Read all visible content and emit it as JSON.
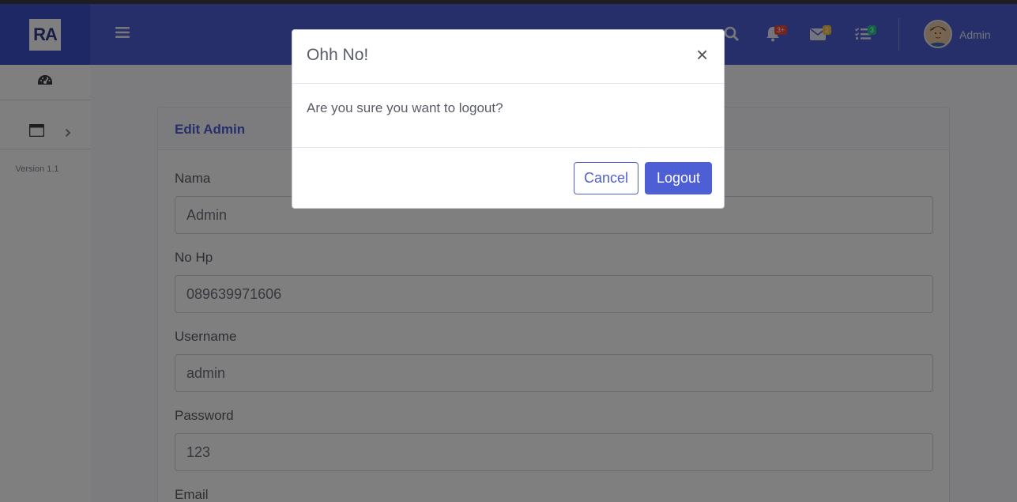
{
  "brand": {
    "logo_text": "RA"
  },
  "sidebar": {
    "version": "Version 1.1"
  },
  "topbar": {
    "alerts_badge": "3+",
    "messages_badge": "2",
    "tasks_badge": "3",
    "username": "Admin"
  },
  "card": {
    "title": "Edit Admin",
    "fields": [
      {
        "label": "Nama",
        "value": "Admin"
      },
      {
        "label": "No Hp",
        "value": "089639971606"
      },
      {
        "label": "Username",
        "value": "admin"
      },
      {
        "label": "Password",
        "value": "123"
      },
      {
        "label": "Email",
        "value": ""
      }
    ]
  },
  "modal": {
    "title": "Ohh No!",
    "close": "×",
    "body": "Are you sure you want to logout?",
    "cancel_label": "Cancel",
    "logout_label": "Logout"
  },
  "colors": {
    "primary": "#4e5fd6",
    "brand": "#3d50c8"
  }
}
